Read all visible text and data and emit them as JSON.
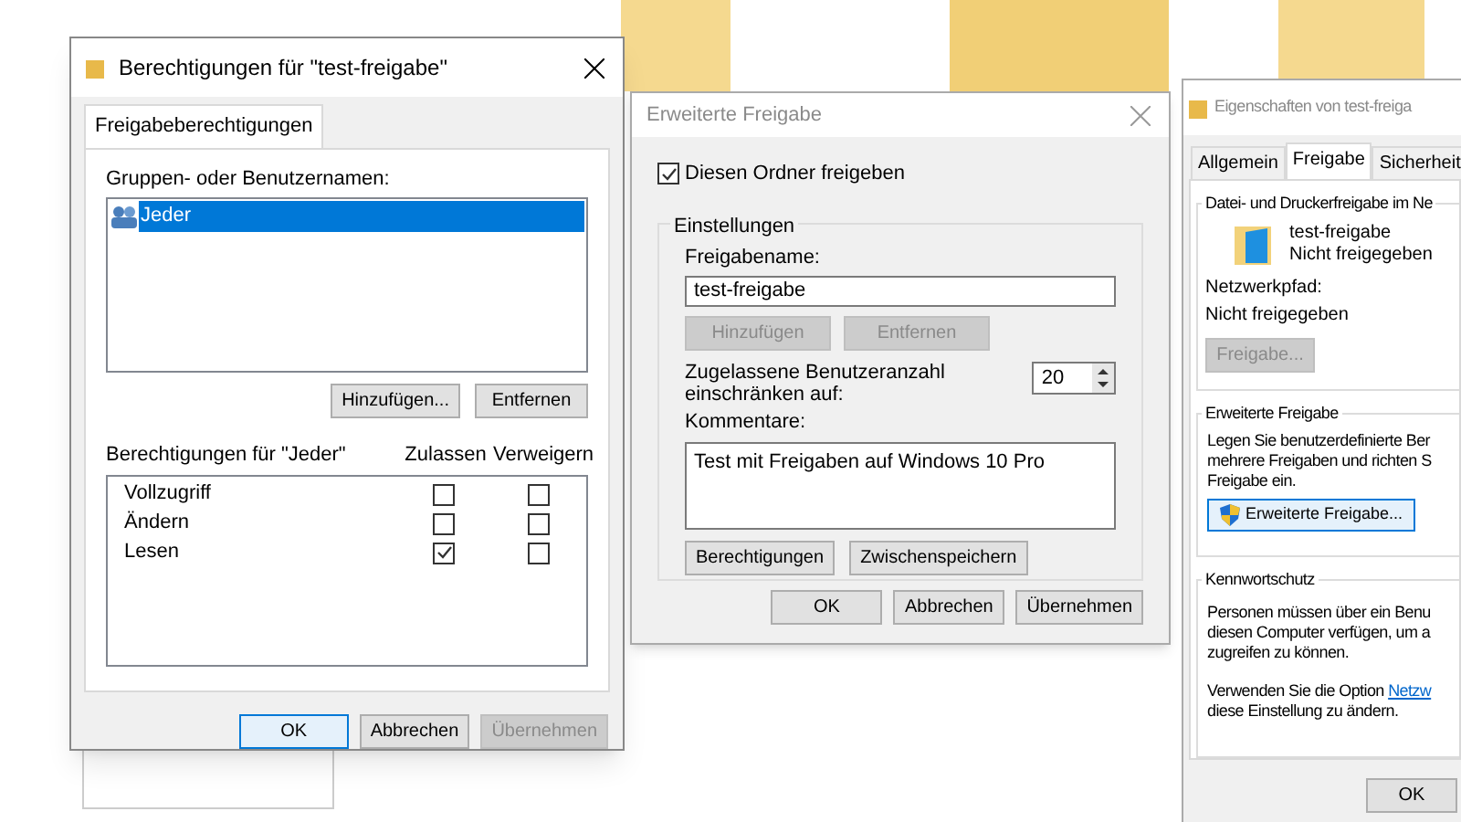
{
  "permissions_dialog": {
    "title": "Berechtigungen für \"test-freigabe\"",
    "active": true,
    "tabs": [
      {
        "label": "Freigabeberechtigungen",
        "selected": true
      }
    ],
    "users_label": "Gruppen- oder Benutzernamen:",
    "users": [
      {
        "name": "Jeder",
        "selected": true
      }
    ],
    "user_buttons": [
      {
        "label": "Hinzufügen...",
        "disabled": false
      },
      {
        "label": "Entfernen",
        "disabled": false
      }
    ],
    "permissions_label": "Berechtigungen für \"Jeder\"",
    "columns": [
      "Zulassen",
      "Verweigern"
    ],
    "permissions": [
      {
        "name": "Vollzugriff",
        "allow": false,
        "deny": false
      },
      {
        "name": "Ändern",
        "allow": false,
        "deny": false
      },
      {
        "name": "Lesen",
        "allow": true,
        "deny": false
      }
    ],
    "footer_buttons": [
      {
        "label": "OK",
        "disabled": false,
        "default": true
      },
      {
        "label": "Abbrechen",
        "disabled": false,
        "default": false
      },
      {
        "label": "Übernehmen",
        "disabled": true,
        "default": false
      }
    ]
  },
  "advanced_dialog": {
    "title": "Erweiterte Freigabe",
    "active": false,
    "share_checkbox": {
      "label": "Diesen Ordner freigeben",
      "checked": true
    },
    "group_title": "Einstellungen",
    "share_name_label": "Freigabename:",
    "share_name": "test-freigabe",
    "name_buttons": [
      {
        "label": "Hinzufügen",
        "disabled": true
      },
      {
        "label": "Entfernen",
        "disabled": true
      }
    ],
    "limit_label": "Zugelassene Benutzeranzahl einschränken auf:",
    "limit_value": "20",
    "comment_label": "Kommentare:",
    "comment": "Test mit Freigaben auf Windows 10 Pro",
    "action_buttons": [
      {
        "label": "Berechtigungen",
        "disabled": false
      },
      {
        "label": "Zwischenspeichern",
        "disabled": false
      }
    ],
    "footer_buttons": [
      {
        "label": "OK",
        "disabled": false,
        "default": false
      },
      {
        "label": "Abbrechen",
        "disabled": false,
        "default": false
      },
      {
        "label": "Übernehmen",
        "disabled": false,
        "default": false
      }
    ]
  },
  "properties_dialog": {
    "title": "Eigenschaften von test-freiga",
    "active": false,
    "tabs": [
      {
        "label": "Allgemein",
        "selected": false
      },
      {
        "label": "Freigabe",
        "selected": true
      },
      {
        "label": "Sicherheit",
        "selected": false
      }
    ],
    "network_group": {
      "title": "Datei- und Druckerfreigabe im Ne",
      "folder_name": "test-freigabe",
      "folder_status": "Nicht freigegeben",
      "path_label": "Netzwerkpfad:",
      "path_value": "Nicht freigegeben",
      "button": {
        "label": "Freigabe...",
        "disabled": true
      }
    },
    "advanced_group": {
      "title": "Erweiterte Freigabe",
      "lines": [
        "Legen Sie benutzerdefinierte Ber",
        "mehrere Freigaben und richten S",
        "Freigabe ein."
      ],
      "button": {
        "label": "Erweiterte Freigabe...",
        "disabled": false,
        "default": true
      }
    },
    "password_group": {
      "title": "Kennwortschutz",
      "lines": [
        "Personen müssen über ein Benu",
        "diesen Computer verfügen, um a",
        "zugreifen zu können."
      ],
      "option_text": "Verwenden Sie die Option",
      "option_link": "Netzw",
      "option_end": "diese Einstellung zu ändern."
    },
    "footer_buttons": [
      {
        "label": "OK",
        "disabled": false,
        "default": false
      }
    ]
  }
}
